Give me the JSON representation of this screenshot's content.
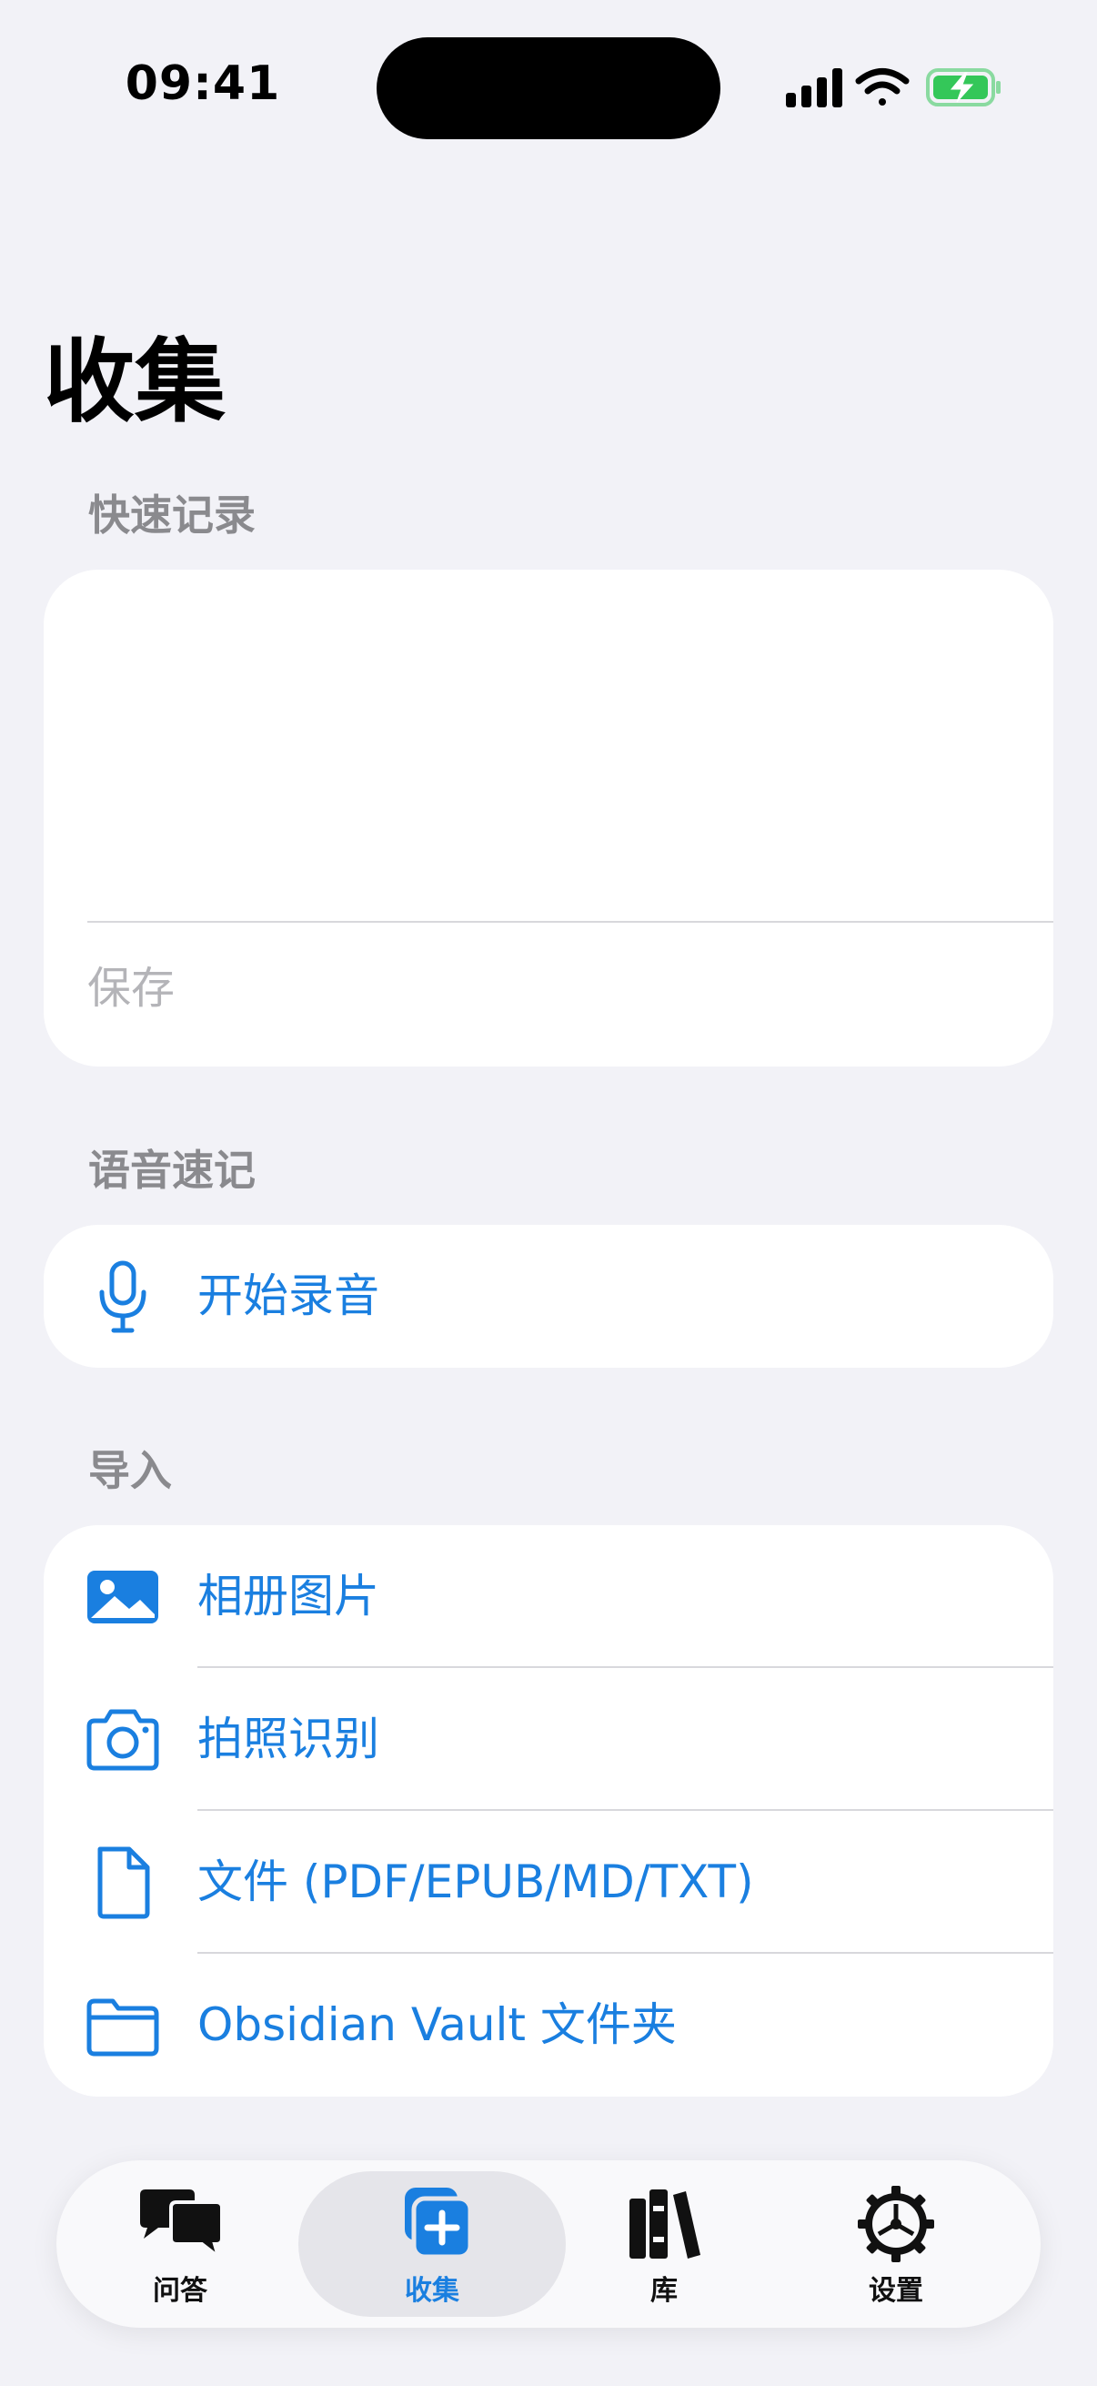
{
  "status_bar": {
    "time": "09:41"
  },
  "page": {
    "title": "收集"
  },
  "quick_note": {
    "header": "快速记录",
    "text_value": "",
    "save_label": "保存"
  },
  "voice_note": {
    "header": "语音速记",
    "record_label": "开始录音"
  },
  "import": {
    "header": "导入",
    "items": [
      {
        "label": "相册图片",
        "icon": "photo-icon"
      },
      {
        "label": "拍照识别",
        "icon": "camera-icon"
      },
      {
        "label": "文件 (PDF/EPUB/MD/TXT)",
        "icon": "document-icon"
      },
      {
        "label": "Obsidian Vault 文件夹",
        "icon": "folder-icon"
      }
    ]
  },
  "tab_bar": {
    "tabs": [
      {
        "label": "问答",
        "icon": "chat-bubbles-icon"
      },
      {
        "label": "收集",
        "icon": "add-collection-icon",
        "active": true
      },
      {
        "label": "库",
        "icon": "library-books-icon"
      },
      {
        "label": "设置",
        "icon": "gear-icon"
      }
    ]
  },
  "colors": {
    "accent": "#1a7fe0",
    "background": "#f2f2f7",
    "card": "#ffffff",
    "secondary_text": "#8a8a8e",
    "battery_green": "#34c759"
  }
}
